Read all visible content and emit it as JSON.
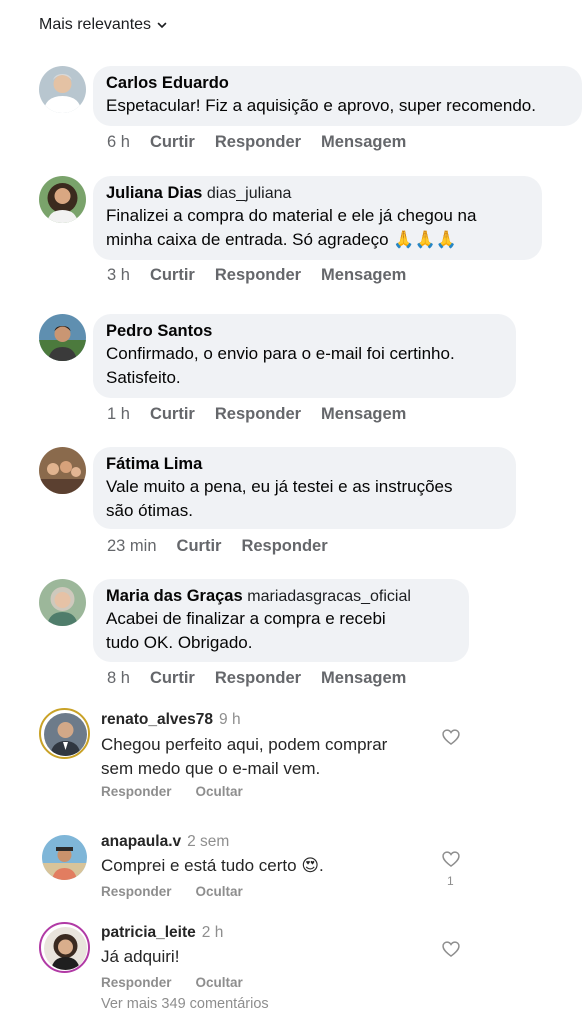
{
  "sort": {
    "label": "Mais relevantes"
  },
  "fb_comments": [
    {
      "name": "Carlos Eduardo",
      "handle": "",
      "lines": [
        "Espetacular! Fiz a aquisição e aprovo, super recomendo."
      ],
      "time": "6 h",
      "actions": [
        "Curtir",
        "Responder",
        "Mensagem"
      ]
    },
    {
      "name": "Juliana Dias",
      "handle": "dias_juliana",
      "lines": [
        "Finalizei a compra do material e ele já chegou na",
        "minha caixa de entrada. Só agradeço 🙏🙏🙏"
      ],
      "time": "3 h",
      "actions": [
        "Curtir",
        "Responder",
        "Mensagem"
      ]
    },
    {
      "name": "Pedro Santos",
      "handle": "",
      "lines": [
        "Confirmado, o envio para o e-mail foi certinho.",
        "Satisfeito."
      ],
      "time": "1 h",
      "actions": [
        "Curtir",
        "Responder",
        "Mensagem"
      ]
    },
    {
      "name": "Fátima Lima",
      "handle": "",
      "lines": [
        "Vale muito a pena, eu já testei e as instruções",
        "são ótimas."
      ],
      "time": "23 min",
      "actions": [
        "Curtir",
        "Responder"
      ]
    },
    {
      "name": "Maria das Graças",
      "handle": "mariadasgracas_oficial",
      "lines": [
        "Acabei de finalizar a compra e recebi",
        "tudo OK. Obrigado."
      ],
      "time": "8 h",
      "actions": [
        "Curtir",
        "Responder",
        "Mensagem"
      ]
    }
  ],
  "ig_comments": [
    {
      "user": "renato_alves78",
      "time": "9 h",
      "lines": [
        "Chegou perfeito aqui, podem comprar",
        "sem medo que o e-mail vem."
      ],
      "actions": [
        "Responder",
        "Ocultar"
      ],
      "likes": ""
    },
    {
      "user": "anapaula.v",
      "time": "2 sem",
      "lines": [
        "Comprei e está tudo certo 😍."
      ],
      "actions": [
        "Responder",
        "Ocultar"
      ],
      "likes": "1"
    },
    {
      "user": "patricia_leite",
      "time": "2 h",
      "lines": [
        "Já adquiri!"
      ],
      "actions": [
        "Responder",
        "Ocultar"
      ],
      "likes": ""
    }
  ],
  "more_link": "Ver mais 349 comentários",
  "icons": {
    "sort": "chevron-down-icon",
    "like": "heart-icon"
  },
  "colors": {
    "bubble": "#f0f2f5",
    "meta": "#65676b",
    "ig_meta": "#8e8e8e"
  }
}
